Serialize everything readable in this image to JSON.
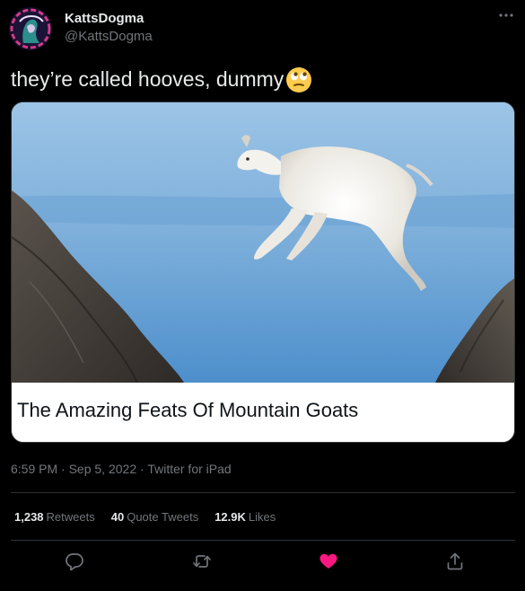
{
  "author": {
    "name": "KattsDogma",
    "handle": "@KattsDogma"
  },
  "tweet": {
    "text": "they’re called hooves, dummy",
    "emoji": "face-with-rolling-eyes"
  },
  "card": {
    "title": "The Amazing Feats Of Mountain Goats"
  },
  "meta": {
    "time": "6:59 PM",
    "separator1": " · ",
    "date": "Sep 5, 2022",
    "separator2": " · ",
    "client": "Twitter for iPad"
  },
  "stats": {
    "retweets_count": "1,238",
    "retweets_label": "Retweets",
    "quotes_count": "40",
    "quotes_label": "Quote Tweets",
    "likes_count": "12.9K",
    "likes_label": "Likes"
  },
  "colors": {
    "background": "#000000",
    "text": "#e7e9ea",
    "secondary": "#71767b",
    "like": "#f91880",
    "divider": "#2f3336"
  },
  "icons": {
    "more": "more-horizontal-icon",
    "reply": "reply-icon",
    "retweet": "retweet-icon",
    "like": "heart-icon",
    "share": "share-icon"
  }
}
